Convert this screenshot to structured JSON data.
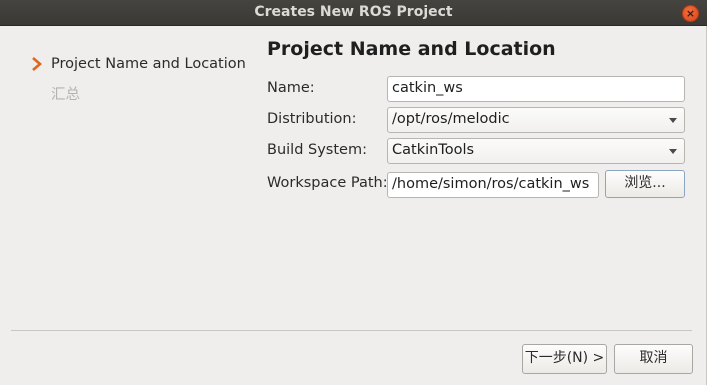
{
  "window": {
    "title": "Creates New ROS Project",
    "close_glyph": "×"
  },
  "steps": [
    {
      "label": "Project Name and Location",
      "active": true
    },
    {
      "label": "汇总",
      "active": false
    }
  ],
  "page": {
    "title": "Project Name and Location"
  },
  "form": {
    "name_label": "Name:",
    "name_value": "catkin_ws",
    "distribution_label": "Distribution:",
    "distribution_value": "/opt/ros/melodic",
    "build_system_label": "Build System:",
    "build_system_value": "CatkinTools",
    "workspace_label": "Workspace Path:",
    "workspace_value": "/home/simon/ros/catkin_ws",
    "browse_label": "浏览..."
  },
  "buttons": {
    "next_label": "下一步(N) >",
    "cancel_label": "取消"
  },
  "colors": {
    "accent_arrow": "#e0661e",
    "titlebar": "#3d3c38",
    "background": "#efeeec"
  }
}
